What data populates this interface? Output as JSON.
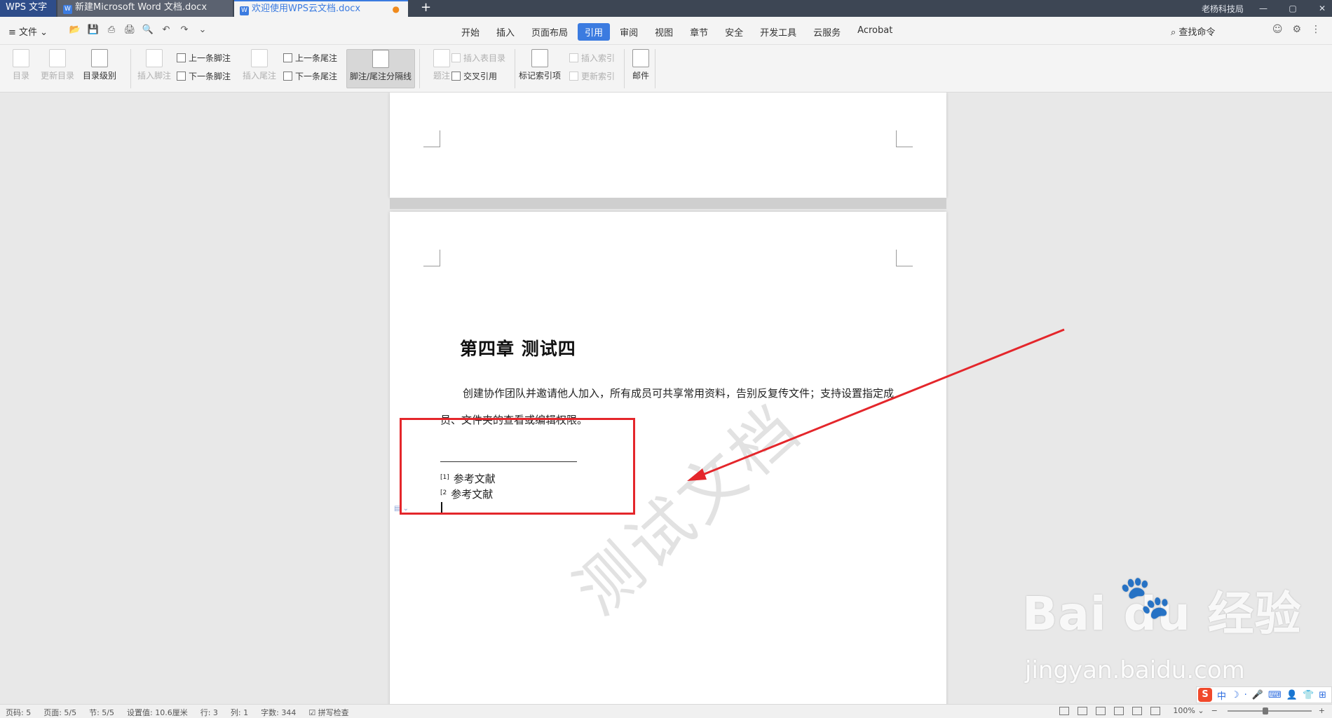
{
  "titlebar": {
    "app_tab": "WPS 文字",
    "doc_tabs": [
      {
        "label": "新建Microsoft Word 文档.docx",
        "icon": "W"
      },
      {
        "label": "欢迎使用WPS云文档.docx",
        "icon": "W",
        "unsaved": "●"
      }
    ],
    "new_tab": "+",
    "user": "老杨科技局",
    "controls": [
      "—",
      "▢",
      "✕"
    ]
  },
  "menubar": {
    "file": "≡ 文件 ⌄",
    "quick_tools": [
      "📂",
      "💾",
      "⎙",
      "🖨",
      "🔍",
      "↶",
      "↷",
      "⌄"
    ],
    "tabs": [
      "开始",
      "插入",
      "页面布局",
      "引用",
      "审阅",
      "视图",
      "章节",
      "安全",
      "开发工具",
      "云服务",
      "Acrobat"
    ],
    "active_tab": "引用",
    "search": "查找命令",
    "right_icons": [
      "☺",
      "⚙",
      "⋮"
    ]
  },
  "ribbon": {
    "toc": "目录",
    "update_toc": "更新目录",
    "toc_level": "目录级别",
    "insert_footnote": "插入脚注",
    "prev_footnote": "上一条脚注",
    "next_footnote": "下一条脚注",
    "insert_endnote": "插入尾注",
    "prev_endnote": "上一条尾注",
    "next_endnote": "下一条尾注",
    "separator": "脚注/尾注分隔线",
    "caption": "题注",
    "insert_table_toc": "插入表目录",
    "cross_ref": "交叉引用",
    "mark_index": "标记索引项",
    "insert_index": "插入索引",
    "update_index": "更新索引",
    "mail": "邮件"
  },
  "document": {
    "chapter_title": "第四章  测试四",
    "paragraph": "创建协作团队并邀请他人加入，所有成员可共享常用资料，告别反复传文件；支持设置指定成员、文件夹的查看或编辑权限。",
    "footnotes": [
      {
        "mark": "[1]",
        "text": "参考文献"
      },
      {
        "mark": "[2",
        "text": "参考文献"
      }
    ],
    "watermark": "测试文档"
  },
  "overlay": {
    "baidu_logo": "Bai  du 经验",
    "baidu_url": "jingyan.baidu.com",
    "box_color": "#e4262b"
  },
  "ime": [
    "S",
    "中",
    "☽",
    "·",
    "🎤",
    "⌨",
    "👤",
    "👕",
    "⊞"
  ],
  "statusbar": {
    "items": [
      "页码: 5",
      "页面: 5/5",
      "节: 5/5",
      "设置值: 10.6厘米",
      "行: 3",
      "列: 1",
      "字数: 344",
      "☑ 拼写检查"
    ],
    "zoom": "100% ⌄",
    "zoom_level": 0.45
  },
  "colors": {
    "accent": "#3b7be0",
    "annotation": "#e4262b"
  }
}
